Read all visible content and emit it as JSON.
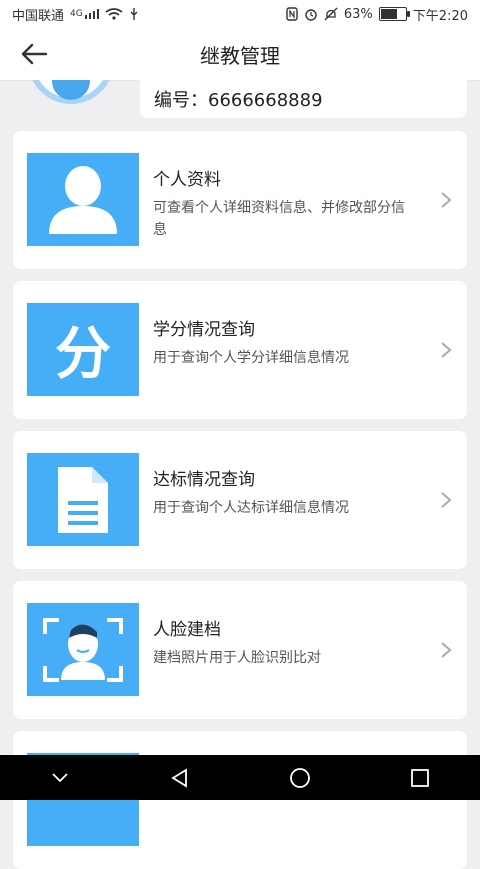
{
  "status": {
    "carrier": "中国联通",
    "signal_label": "4G",
    "battery_pct": "63%",
    "time": "下午2:20"
  },
  "header": {
    "title": "继教管理"
  },
  "profile": {
    "number": "编号：6666668889"
  },
  "cards": [
    {
      "title": "个人资料",
      "desc": "可查看个人详细资料信息、并修改部分信息",
      "icon": "user-icon"
    },
    {
      "title": "学分情况查询",
      "desc": "用于查询个人学分详细信息情况",
      "icon": "credit-icon",
      "glyph": "分"
    },
    {
      "title": "达标情况查询",
      "desc": "用于查询个人达标详细信息情况",
      "icon": "document-icon"
    },
    {
      "title": "人脸建档",
      "desc": "建档照片用于人脸识别比对",
      "icon": "face-scan-icon"
    }
  ],
  "colors": {
    "accent": "#46aef7"
  }
}
